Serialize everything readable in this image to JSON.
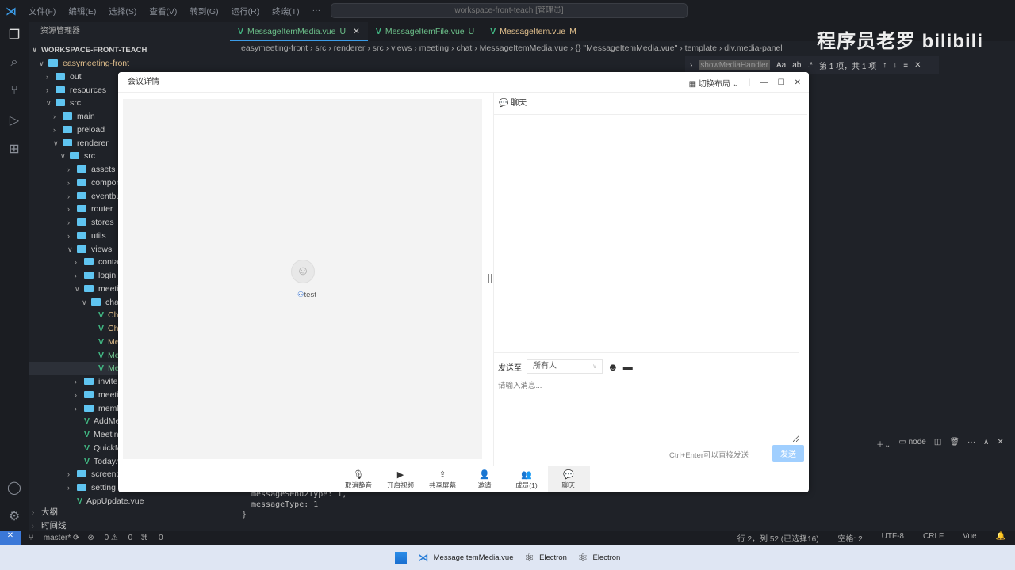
{
  "menubar": {
    "items": [
      "文件(F)",
      "编辑(E)",
      "选择(S)",
      "查看(V)",
      "转到(G)",
      "运行(R)",
      "终端(T)",
      "···"
    ],
    "search": "workspace-front-teach [管理员]"
  },
  "sidebar": {
    "title": "资源管理器",
    "workspace": "WORKSPACE-FRONT-TEACH",
    "rows": [
      {
        "label": "easymeeting-front",
        "depth": 1,
        "type": "folder",
        "open": true
      },
      {
        "label": "out",
        "depth": 2,
        "type": "folder"
      },
      {
        "label": "resources",
        "depth": 2,
        "type": "folder"
      },
      {
        "label": "src",
        "depth": 2,
        "type": "folder",
        "open": true
      },
      {
        "label": "main",
        "depth": 3,
        "type": "folder"
      },
      {
        "label": "preload",
        "depth": 3,
        "type": "folder"
      },
      {
        "label": "renderer",
        "depth": 3,
        "type": "folder",
        "open": true
      },
      {
        "label": "src",
        "depth": 4,
        "type": "folder",
        "open": true
      },
      {
        "label": "assets",
        "depth": 5,
        "type": "folder"
      },
      {
        "label": "componen",
        "depth": 5,
        "type": "folder"
      },
      {
        "label": "eventbus",
        "depth": 5,
        "type": "folder"
      },
      {
        "label": "router",
        "depth": 5,
        "type": "folder"
      },
      {
        "label": "stores",
        "depth": 5,
        "type": "folder"
      },
      {
        "label": "utils",
        "depth": 5,
        "type": "folder"
      },
      {
        "label": "views",
        "depth": 5,
        "type": "folder",
        "open": true
      },
      {
        "label": "contact",
        "depth": 6,
        "type": "folder"
      },
      {
        "label": "login",
        "depth": 6,
        "type": "folder"
      },
      {
        "label": "meeting",
        "depth": 6,
        "type": "folder",
        "open": true
      },
      {
        "label": "chat",
        "depth": 7,
        "type": "folder",
        "open": true
      },
      {
        "label": "ChatPa",
        "depth": 8,
        "type": "file",
        "color": "#e2c08d"
      },
      {
        "label": "ChatSe",
        "depth": 8,
        "type": "file",
        "color": "#e2c08d"
      },
      {
        "label": "Messa",
        "depth": 8,
        "type": "file",
        "color": "#e2c08d"
      },
      {
        "label": "Messa",
        "depth": 8,
        "type": "file",
        "color": "#73c991"
      },
      {
        "label": "Messa",
        "depth": 8,
        "type": "file",
        "color": "#73c991",
        "selected": true
      },
      {
        "label": "invite",
        "depth": 6,
        "type": "folder"
      },
      {
        "label": "meeting",
        "depth": 6,
        "type": "folder"
      },
      {
        "label": "membe",
        "depth": 6,
        "type": "folder"
      },
      {
        "label": "AddMe",
        "depth": 6,
        "type": "file"
      },
      {
        "label": "Meeting",
        "depth": 6,
        "type": "file"
      },
      {
        "label": "QuickM",
        "depth": 6,
        "type": "file"
      },
      {
        "label": "Today.v",
        "depth": 6,
        "type": "file"
      },
      {
        "label": "screenca",
        "depth": 5,
        "type": "folder"
      },
      {
        "label": "setting",
        "depth": 5,
        "type": "folder"
      },
      {
        "label": "AppUpdate.vue",
        "depth": 5,
        "type": "file"
      }
    ],
    "outline": "大纲",
    "timeline": "时间线"
  },
  "tabs": [
    {
      "label": "MessageItemMedia.vue",
      "badge": "U",
      "active": true
    },
    {
      "label": "MessageItemFile.vue",
      "badge": "U"
    },
    {
      "label": "MessageItem.vue",
      "badge": "M"
    }
  ],
  "breadcrumb": [
    "easymeeting-front",
    "src",
    "renderer",
    "src",
    "views",
    "meeting",
    "chat",
    "MessageItemMedia.vue",
    "{} \"MessageItemMedia.vue\"",
    "template",
    "div.media-panel"
  ],
  "find": {
    "query": "showMediaHandler",
    "result": "第 1 项，共 1 项"
  },
  "watermark": "程序员老罗 bilibili",
  "code": [
    "messageSend2Type: 1,",
    "messageType: 1",
    "}"
  ],
  "terminal": {
    "shell": "node"
  },
  "status": {
    "branch": "master*",
    "errors": "0",
    "warnings": "0",
    "ports": "0",
    "position": "行 2，列 52 (已选择16)",
    "spaces": "空格: 2",
    "encoding": "UTF-8",
    "eol": "CRLF",
    "lang": "Vue"
  },
  "taskbar": [
    {
      "label": "MessageItemMedia.vue"
    },
    {
      "label": "Electron"
    },
    {
      "label": "Electron"
    }
  ],
  "dialog": {
    "title": "会议详情",
    "layout": "切换布局",
    "user": "test",
    "chat": {
      "title": "聊天",
      "send_to_label": "发送至",
      "send_to": "所有人",
      "placeholder": "请输入消息...",
      "hint": "Ctrl+Enter可以直接发送",
      "send": "发送"
    },
    "toolbar": [
      {
        "label": "取消静音",
        "icon": "mic-icon"
      },
      {
        "label": "开启视频",
        "icon": "video-off-icon"
      },
      {
        "label": "共享屏幕",
        "icon": "share-screen-icon"
      },
      {
        "label": "邀请",
        "icon": "invite-icon"
      },
      {
        "label": "成员(1)",
        "icon": "members-icon"
      },
      {
        "label": "聊天",
        "icon": "chat-icon",
        "active": true
      }
    ]
  }
}
